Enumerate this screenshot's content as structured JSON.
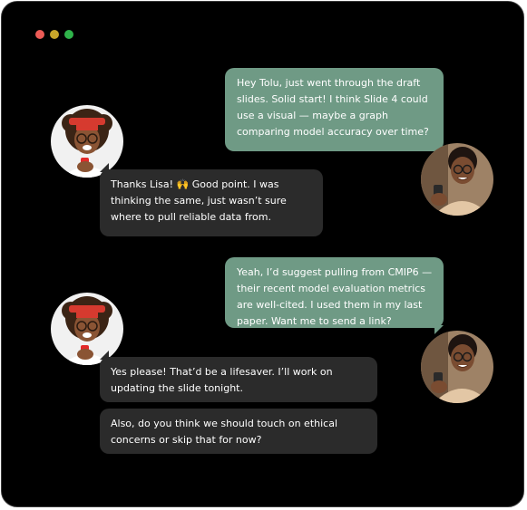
{
  "window": {
    "dots": [
      "#ec5b56",
      "#c7a52a",
      "#2fb34a"
    ]
  },
  "messages": [
    {
      "sender": "right",
      "text": "Hey Tolu, just went through the draft slides. Solid start! I think Slide 4 could use a visual — maybe a graph comparing model accuracy over time?"
    },
    {
      "sender": "left",
      "text": "Thanks Lisa! 🙌 Good point. I was thinking the same, just wasn’t sure where to pull reliable data from."
    },
    {
      "sender": "right",
      "text": "Yeah, I’d suggest pulling from CMIP6 — their recent model evaluation metrics are well-cited. I used them in my last paper. Want me to send a link?"
    },
    {
      "sender": "left",
      "text": "Yes please! That’d be a lifesaver. I’ll work on updating the slide tonight."
    },
    {
      "sender": "left",
      "text": "Also, do you think we should touch on ethical concerns or skip that for now?"
    }
  ],
  "colors": {
    "right_bubble": "#6f9a85",
    "left_bubble": "#2b2b2b",
    "window_bg": "#000000"
  }
}
